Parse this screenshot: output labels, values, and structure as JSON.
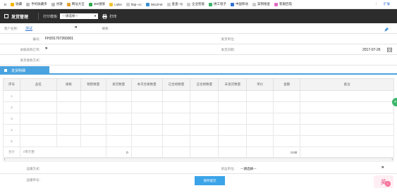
{
  "bookmarks": [
    {
      "label": "D",
      "color": "#ffffff"
    },
    {
      "label": "收藏",
      "color": "#f5b400"
    },
    {
      "label": "手机收藏夹",
      "color": "#bbbbbb"
    },
    {
      "label": "谷歌",
      "color": "#bbbbbb"
    },
    {
      "label": "网址大全",
      "color": "#e3a12f"
    },
    {
      "label": "360搜索",
      "color": "#2fa84f"
    },
    {
      "label": "Links",
      "color": "#f1c232"
    },
    {
      "label": "http--cc",
      "color": "#cccccc"
    },
    {
      "label": "Wicdi-W",
      "color": "#3b8fd6"
    },
    {
      "label": "查查--Q",
      "color": "#cccccc"
    },
    {
      "label": "企业智能",
      "color": "#cccccc"
    },
    {
      "label": "拼工程子",
      "color": "#3bb36b"
    },
    {
      "label": "中国移动",
      "color": "#2f6fd2"
    },
    {
      "label": "案例搜查",
      "color": "#cccccc"
    },
    {
      "label": "客服回电",
      "color": "#e06cc4"
    }
  ],
  "bookmarks_right": {
    "more": "⋮",
    "ext": "扩展"
  },
  "toolbar": {
    "title": "发货管理",
    "print_template_label": "打印模板:",
    "print_template_value": "---请选择---",
    "print_template_arrow": "»",
    "print_label": "打印"
  },
  "form": {
    "client_label": "客户名称：",
    "client_value": "测试",
    "client_arrow": "»",
    "summary_label": "摘要：",
    "number_label": "编号：",
    "number_value": "FH201707260001",
    "ship_unit_label": "发货单位：",
    "order_label": "关联采购订单：",
    "order_arrow": "»",
    "ship_date_label": "发货日期：",
    "ship_date_value": "2017-07-26",
    "ship_method_label": "发货收款方式："
  },
  "section": {
    "title": "发货明细"
  },
  "table": {
    "headers": [
      "序号",
      "品名",
      "规格",
      "销售数量",
      "发货数量",
      "本次合格数量",
      "已合格数量",
      "应合格数量",
      "未发货数量",
      "单价",
      "金额",
      "备注"
    ],
    "rows": [
      "1",
      "2",
      "3",
      "4",
      "5"
    ],
    "total": {
      "label": "合计",
      "amount_text": "0零元整",
      "qty": "0",
      "amount": "0.00"
    }
  },
  "bottom": {
    "logistics_label": "运输方式：",
    "receiver_label": "承运单位：",
    "receiver_value": "---请选择---",
    "receiver_arrow": "»",
    "tracking_label": "运输单号：",
    "submit_label": "保存提交"
  },
  "ime": {
    "char": "英"
  },
  "side_fab": {
    "icon": "»"
  }
}
